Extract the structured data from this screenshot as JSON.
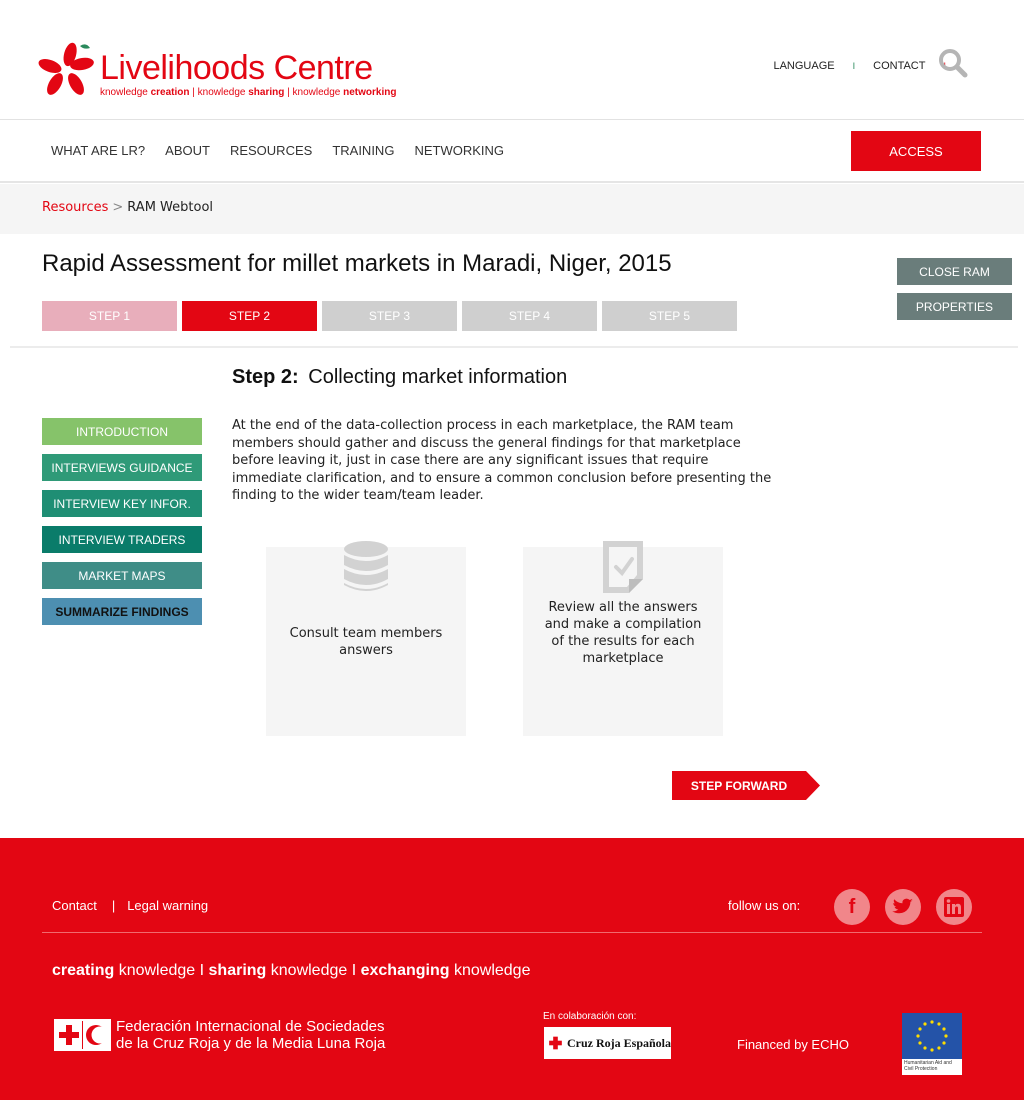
{
  "header": {
    "logo_main": "Livelihoods Centre",
    "logo_tag_parts": [
      "knowledge ",
      "creation",
      " | knowledge ",
      "sharing",
      " | knowledge ",
      "networking"
    ],
    "language": "LANGUAGE",
    "contact": "CONTACT",
    "sep1": "I",
    "sep2": "I"
  },
  "nav": {
    "items": [
      "WHAT ARE LR?",
      "ABOUT",
      "RESOURCES",
      "TRAINING",
      "NETWORKING"
    ],
    "access": "ACCESS"
  },
  "breadcrumb": {
    "link": "Resources",
    "sep": ">",
    "current": "RAM Webtool"
  },
  "page": {
    "title": "Rapid Assessment for millet markets in Maradi, Niger, 2015",
    "steps": [
      "STEP 1",
      "STEP 2",
      "STEP 3",
      "STEP 4",
      "STEP 5"
    ],
    "close_ram": "CLOSE RAM",
    "properties": "PROPERTIES",
    "step_label": "Step 2:",
    "step_title": "Collecting market information",
    "body": "At the end of the data-collection process in each marketplace, the RAM team members should gather and discuss the general findings for that marketplace before leaving it, just in case there are any significant issues that require immediate clarification, and to ensure a common conclusion before presenting the finding to the wider team/team leader.",
    "cards": [
      {
        "icon": "database-icon",
        "text": "Consult team members answers"
      },
      {
        "icon": "checked-document-icon",
        "text": "Review all the answers and make a compilation of the results for each marketplace"
      }
    ],
    "forward": "STEP FORWARD"
  },
  "left_menu": [
    "INTRODUCTION",
    "INTERVIEWS GUIDANCE",
    "INTERVIEW KEY INFOR.",
    "INTERVIEW TRADERS",
    "MARKET MAPS",
    "SUMMARIZE FINDINGS"
  ],
  "footer": {
    "contact": "Contact",
    "sep": "|",
    "legal": "Legal warning",
    "follow": "follow us on:",
    "tagline": [
      {
        "b": "creating",
        "t": " knowledge I "
      },
      {
        "b": "sharing",
        "t": " knowledge I "
      },
      {
        "b": "exchanging",
        "t": " knowledge"
      }
    ],
    "ifrc_line1": "Federación Internacional de Sociedades",
    "ifrc_line2": "de la Cruz Roja y de la Media Luna Roja",
    "colab": "En colaboración con:",
    "cre": "Cruz Roja Española",
    "financed": "Financed by ECHO",
    "eu_caption": "Humanitarian Aid and Civil Protection"
  },
  "colors": {
    "brand_red": "#e30613",
    "step_done": "#e8aebb",
    "step_todo": "#cfcfcf",
    "side_btn": "#6a7d7b"
  }
}
